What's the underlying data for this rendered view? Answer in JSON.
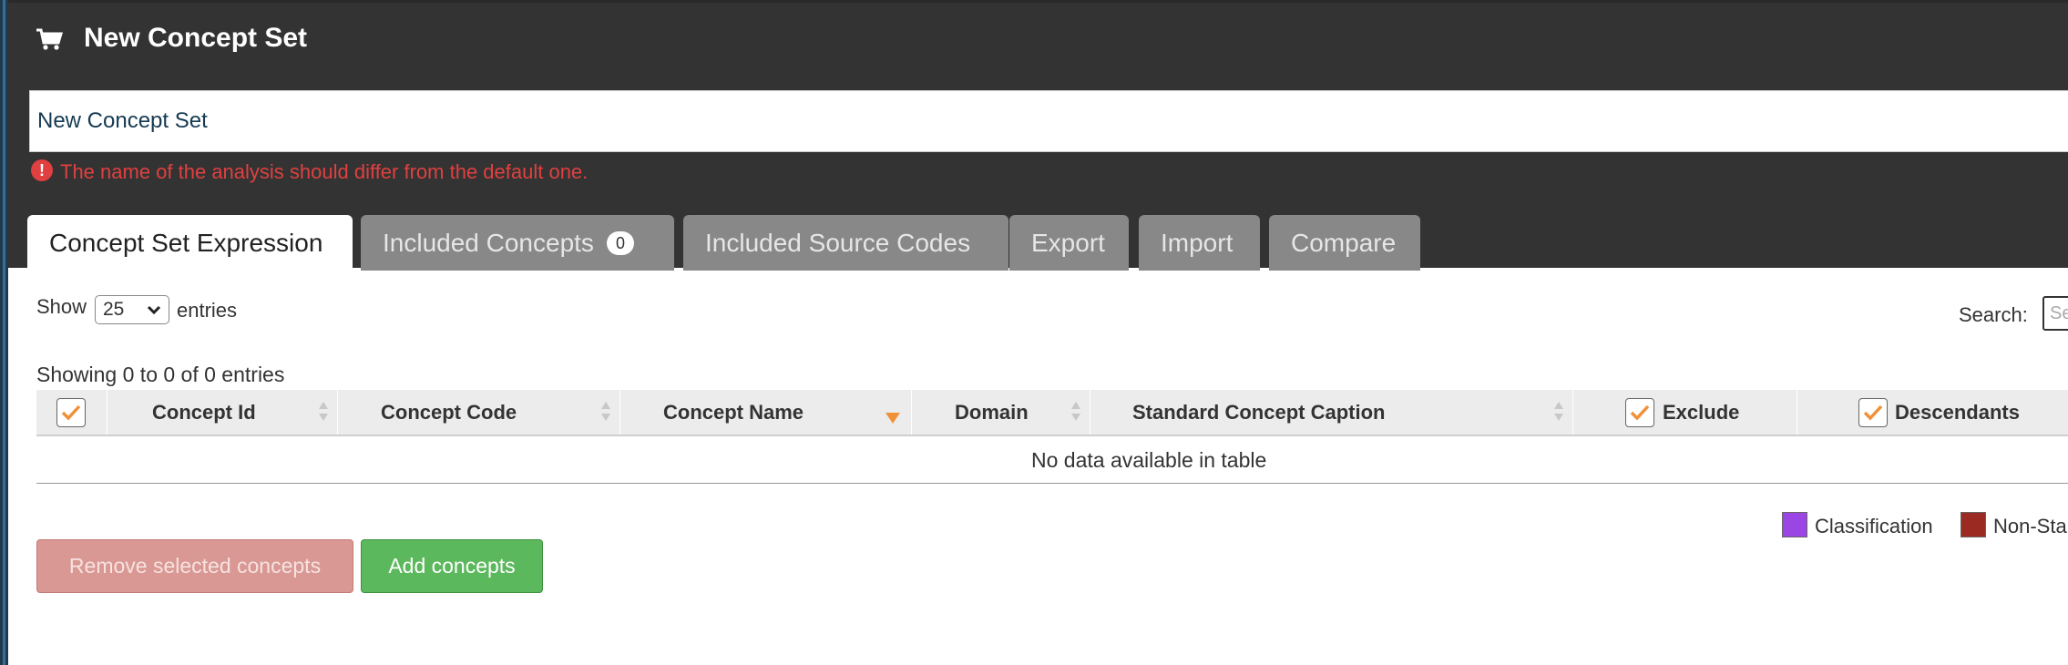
{
  "header": {
    "title": "New Concept Set",
    "name_value": "New Concept Set",
    "error": "The name of the analysis should differ from the default one.",
    "error_icon": "!"
  },
  "tabs": [
    {
      "label": "Concept Set Expression",
      "active": true
    },
    {
      "label": "Included Concepts",
      "badge": "0"
    },
    {
      "label": "Included Source Codes"
    },
    {
      "label": "Export"
    },
    {
      "label": "Import"
    },
    {
      "label": "Compare"
    }
  ],
  "table_controls": {
    "show_label": "Show",
    "page_size": "25",
    "entries_label": "entries",
    "search_label": "Search:",
    "search_placeholder": "Se",
    "info": "Showing 0 to 0 of 0 entries"
  },
  "columns": [
    "Concept Id",
    "Concept Code",
    "Concept Name",
    "Domain",
    "Standard Concept Caption",
    "Exclude",
    "Descendants"
  ],
  "empty_message": "No data available in table",
  "legend": [
    {
      "label": "Classification",
      "color": "#9b45e4"
    },
    {
      "label": "Non-Sta",
      "color": "#9b2a22"
    }
  ],
  "buttons": {
    "remove": "Remove selected concepts",
    "add": "Add concepts"
  },
  "colors": {
    "header_bg": "#333333",
    "check_accent": "#f0913a",
    "error": "#e04040",
    "add_button": "#5cb85c",
    "remove_button": "#d99894"
  }
}
